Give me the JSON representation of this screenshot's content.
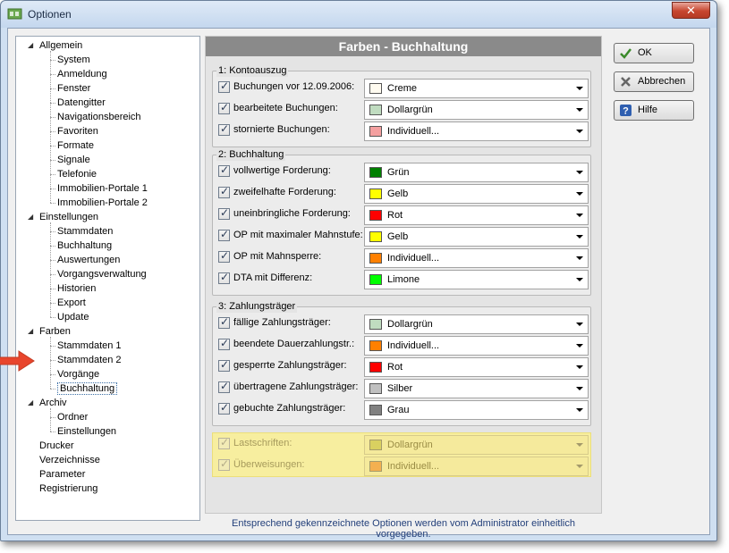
{
  "window": {
    "title": "Optionen",
    "close_glyph": "✕"
  },
  "tree": [
    {
      "label": "Allgemein",
      "level": 0,
      "expanded": true
    },
    {
      "label": "System",
      "level": 1
    },
    {
      "label": "Anmeldung",
      "level": 1
    },
    {
      "label": "Fenster",
      "level": 1
    },
    {
      "label": "Datengitter",
      "level": 1
    },
    {
      "label": "Navigationsbereich",
      "level": 1
    },
    {
      "label": "Favoriten",
      "level": 1
    },
    {
      "label": "Formate",
      "level": 1
    },
    {
      "label": "Signale",
      "level": 1
    },
    {
      "label": "Telefonie",
      "level": 1
    },
    {
      "label": "Immobilien-Portale 1",
      "level": 1
    },
    {
      "label": "Immobilien-Portale 2",
      "level": 1
    },
    {
      "label": "Einstellungen",
      "level": 0,
      "expanded": true
    },
    {
      "label": "Stammdaten",
      "level": 1
    },
    {
      "label": "Buchhaltung",
      "level": 1
    },
    {
      "label": "Auswertungen",
      "level": 1
    },
    {
      "label": "Vorgangsverwaltung",
      "level": 1
    },
    {
      "label": "Historien",
      "level": 1
    },
    {
      "label": "Export",
      "level": 1
    },
    {
      "label": "Update",
      "level": 1
    },
    {
      "label": "Farben",
      "level": 0,
      "expanded": true
    },
    {
      "label": "Stammdaten 1",
      "level": 1
    },
    {
      "label": "Stammdaten 2",
      "level": 1
    },
    {
      "label": "Vorgänge",
      "level": 1
    },
    {
      "label": "Buchhaltung",
      "level": 1,
      "selected": true
    },
    {
      "label": "Archiv",
      "level": 0,
      "expanded": true
    },
    {
      "label": "Ordner",
      "level": 1
    },
    {
      "label": "Einstellungen",
      "level": 1
    },
    {
      "label": "Drucker",
      "level": 0
    },
    {
      "label": "Verzeichnisse",
      "level": 0
    },
    {
      "label": "Parameter",
      "level": 0
    },
    {
      "label": "Registrierung",
      "level": 0
    }
  ],
  "panel": {
    "title": "Farben - Buchhaltung",
    "groups": [
      {
        "title": "1: Kontoauszug",
        "rows": [
          {
            "label": "Buchungen vor 12.09.2006:",
            "checked": true,
            "value": "Creme",
            "color": "#FFFBF0"
          },
          {
            "label": "bearbeitete Buchungen:",
            "checked": true,
            "value": "Dollargrün",
            "color": "#C0DCC0"
          },
          {
            "label": "stornierte Buchungen:",
            "checked": true,
            "value": "Individuell...",
            "color": "#F4A0A0"
          }
        ]
      },
      {
        "title": "2: Buchhaltung",
        "rows": [
          {
            "label": "vollwertige Forderung:",
            "checked": true,
            "value": "Grün",
            "color": "#008000"
          },
          {
            "label": "zweifelhafte Forderung:",
            "checked": true,
            "value": "Gelb",
            "color": "#FFFF00"
          },
          {
            "label": "uneinbringliche Forderung:",
            "checked": true,
            "value": "Rot",
            "color": "#FF0000"
          },
          {
            "label": "OP mit maximaler Mahnstufe:",
            "checked": true,
            "value": "Gelb",
            "color": "#FFFF00"
          },
          {
            "label": "OP mit Mahnsperre:",
            "checked": true,
            "value": "Individuell...",
            "color": "#FF8000"
          },
          {
            "label": "DTA mit Differenz:",
            "checked": true,
            "value": "Limone",
            "color": "#00FF00"
          }
        ]
      },
      {
        "title": "3: Zahlungsträger",
        "rows": [
          {
            "label": "fällige Zahlungsträger:",
            "checked": true,
            "value": "Dollargrün",
            "color": "#C0DCC0"
          },
          {
            "label": "beendete Dauerzahlungstr.:",
            "checked": true,
            "value": "Individuell...",
            "color": "#FF8000"
          },
          {
            "label": "gesperrte Zahlungsträger:",
            "checked": true,
            "value": "Rot",
            "color": "#FF0000"
          },
          {
            "label": "übertragene Zahlungsträger:",
            "checked": true,
            "value": "Silber",
            "color": "#C0C0C0"
          },
          {
            "label": "gebuchte Zahlungsträger:",
            "checked": true,
            "value": "Grau",
            "color": "#808080"
          }
        ]
      }
    ],
    "admin_rows": [
      {
        "label": "Lastschriften:",
        "checked": true,
        "value": "Dollargrün",
        "color": "#D9D060"
      },
      {
        "label": "Überweisungen:",
        "checked": true,
        "value": "Individuell...",
        "color": "#F4B050"
      }
    ]
  },
  "buttons": {
    "ok": "OK",
    "cancel": "Abbrechen",
    "help": "Hilfe"
  },
  "footer_note": "Entsprechend gekennzeichnete Optionen werden vom Administrator einheitlich vorgegeben.",
  "colors": {
    "accent_arrow": "#E8452C",
    "header_bar": "#8A8A8A",
    "admin_highlight": "#F7EE9F"
  }
}
